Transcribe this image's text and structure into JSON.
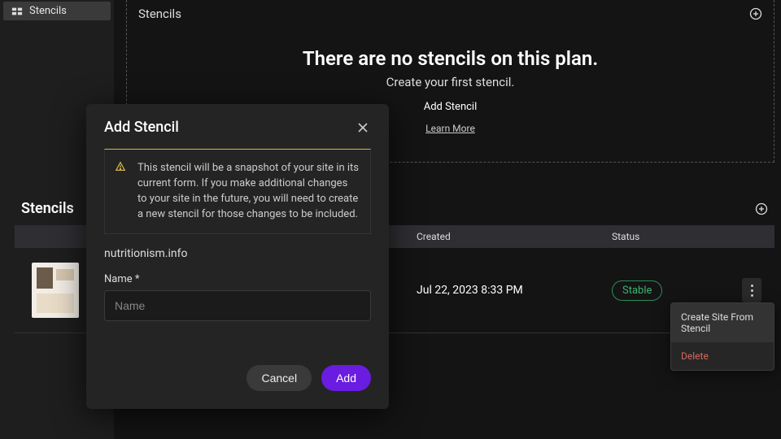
{
  "sidebar": {
    "item_label": "Stencils"
  },
  "empty_panel": {
    "title": "Stencils",
    "headline": "There are no stencils on this plan.",
    "subline": "Create your first stencil.",
    "add_label": "Add Stencil",
    "learn_more_label": "Learn More"
  },
  "table": {
    "title": "Stencils",
    "columns": {
      "created": "Created",
      "status": "Status"
    },
    "rows": [
      {
        "created": "Jul 22, 2023 8:33 PM",
        "status": "Stable"
      }
    ],
    "row_menu": {
      "create_site": "Create Site From Stencil",
      "delete": "Delete"
    }
  },
  "modal": {
    "title": "Add Stencil",
    "alert": "This stencil will be a snapshot of your site in its current form. If you make additional changes to your site in the future, you will need to create a new stencil for those changes to be included.",
    "site_label": "nutritionism.info",
    "name_label": "Name *",
    "name_placeholder": "Name",
    "cancel_label": "Cancel",
    "add_label": "Add"
  }
}
